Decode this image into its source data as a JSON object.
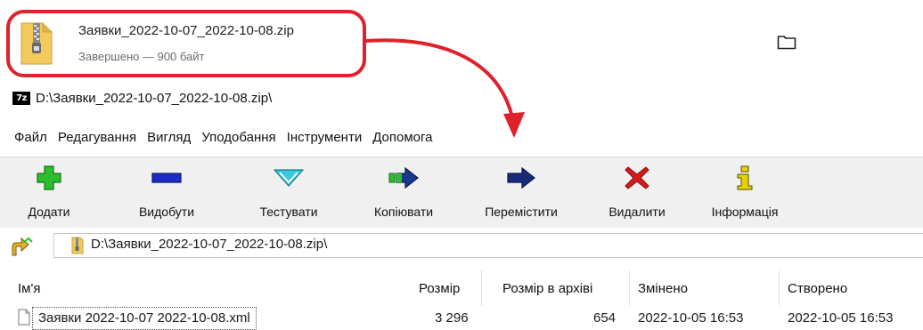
{
  "download": {
    "filename": "Заявки_2022-10-07_2022-10-08.zip",
    "status": "Завершено — 900 байт"
  },
  "window": {
    "logo": "7z",
    "title": "D:\\Заявки_2022-10-07_2022-10-08.zip\\"
  },
  "menu": [
    "Файл",
    "Редагування",
    "Вигляд",
    "Уподобання",
    "Інструменти",
    "Допомога"
  ],
  "toolbar": {
    "add": "Додати",
    "extract": "Видобути",
    "test": "Тестувати",
    "copy": "Копіювати",
    "move": "Перемістити",
    "delete": "Видалити",
    "info": "Інформація"
  },
  "address": {
    "path": "D:\\Заявки_2022-10-07_2022-10-08.zip\\"
  },
  "columns": {
    "name": "Ім'я",
    "size": "Розмір",
    "packed": "Розмір в архіві",
    "modified": "Змінено",
    "created": "Створено"
  },
  "files": [
    {
      "name": "Заявки 2022-10-07 2022-10-08.xml",
      "size": "3 296",
      "packed": "654",
      "modified": "2022-10-05 16:53",
      "created": "2022-10-05 16:53"
    }
  ],
  "colors": {
    "annotation": "#e0202a",
    "add_icon": "#2bbf2b",
    "extract_icon": "#1c2bc8",
    "test_icon": "#36c9e0",
    "copy_icon": "#1b3a8c",
    "move_icon": "#1b2a78",
    "delete_icon": "#d81a1a",
    "info_icon": "#c8b800"
  }
}
